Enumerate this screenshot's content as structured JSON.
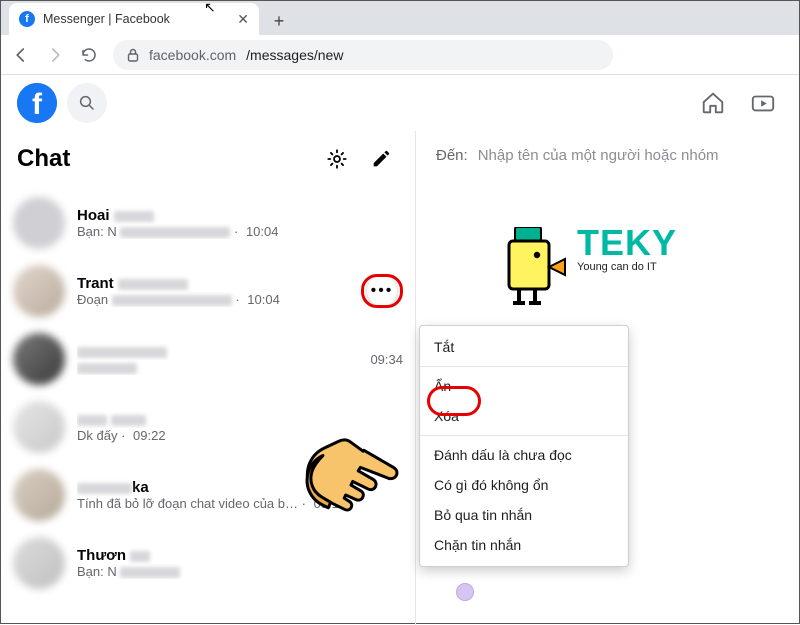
{
  "browser": {
    "tab_title": "Messenger | Facebook",
    "url_host": "facebook.com",
    "url_path": "/messages/new"
  },
  "header": {
    "chat_title": "Chat"
  },
  "compose": {
    "to_label": "Đến:",
    "placeholder": "Nhập tên của một người hoặc nhóm"
  },
  "chats": [
    {
      "name": "Hoai",
      "sub_prefix": "Bạn: N",
      "time": "10:04"
    },
    {
      "name": "Trant",
      "sub_prefix": "Đoạn",
      "time": "10:04",
      "has_more": true
    },
    {
      "name": "",
      "sub_prefix": "",
      "time": "09:34"
    },
    {
      "name": "",
      "sub_prefix": "Dk đấy",
      "time": "09:22"
    },
    {
      "name": "ka",
      "sub_prefix": "Tính đã bỏ lỡ đoạn chat video của b…",
      "time": "08:19"
    },
    {
      "name": "Thươn",
      "sub_prefix": "Bạn: N",
      "time": ""
    }
  ],
  "menu": {
    "items": [
      "Tắt",
      "Ẩn",
      "Xóa",
      "Đánh dấu là chưa đọc",
      "Có gì đó không ổn",
      "Bỏ qua tin nhắn",
      "Chặn tin nhắn"
    ]
  },
  "teky": {
    "brand": "TEKY",
    "slogan": "Young can do IT"
  }
}
